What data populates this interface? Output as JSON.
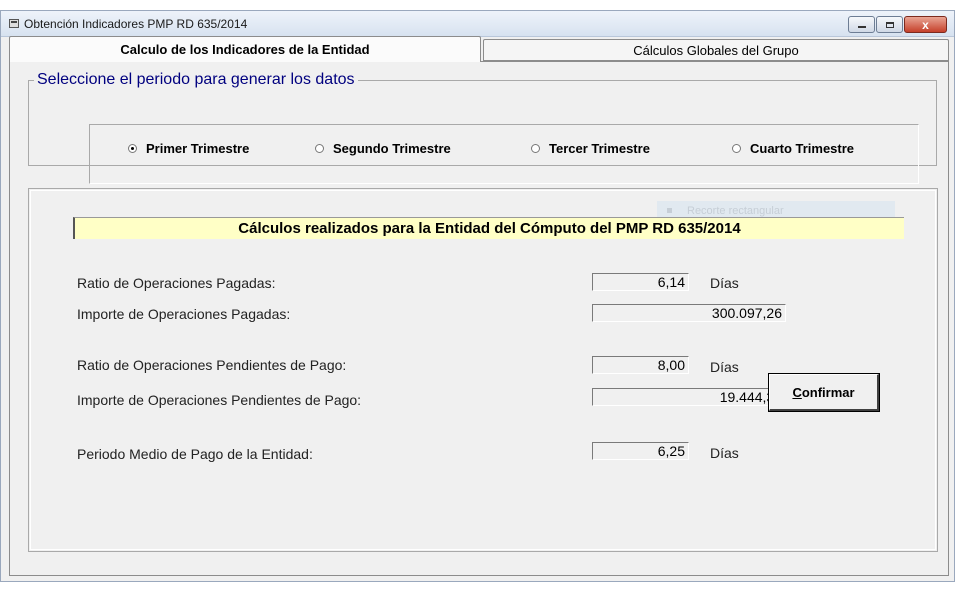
{
  "window": {
    "title": "Obtención Indicadores PMP RD 635/2014",
    "close_glyph": "x"
  },
  "tabs": [
    {
      "label": "Calculo de los Indicadores de la Entidad",
      "active": true
    },
    {
      "label": "Cálculos Globales del Grupo",
      "active": false
    }
  ],
  "period_group": {
    "legend": "Seleccione el periodo para generar los datos",
    "options": [
      {
        "label": "Primer Trimestre",
        "checked": true
      },
      {
        "label": "Segundo Trimestre",
        "checked": false
      },
      {
        "label": "Tercer Trimestre",
        "checked": false
      },
      {
        "label": "Cuarto Trimestre",
        "checked": false
      }
    ]
  },
  "results": {
    "banner": "Cálculos realizados para la Entidad del Cómputo del PMP RD 635/2014",
    "ghost_text": "Recorte rectangular",
    "rows": [
      {
        "label": "Ratio de Operaciones Pagadas:",
        "value": "6,14",
        "unit": "Días"
      },
      {
        "label": "Importe de Operaciones Pagadas:",
        "value": "300.097,26",
        "unit": ""
      },
      {
        "label": "Ratio de Operaciones Pendientes de Pago:",
        "value": "8,00",
        "unit": "Días"
      },
      {
        "label": "Importe de Operaciones Pendientes de Pago:",
        "value": "19.444,38",
        "unit": ""
      },
      {
        "label": "Periodo Medio de Pago de la Entidad:",
        "value": "6,25",
        "unit": "Días"
      }
    ]
  },
  "confirm_button": {
    "accel": "C",
    "rest": "onfirmar"
  },
  "colors": {
    "banner_bg": "#ffffc6",
    "legend_text": "#00007f"
  }
}
